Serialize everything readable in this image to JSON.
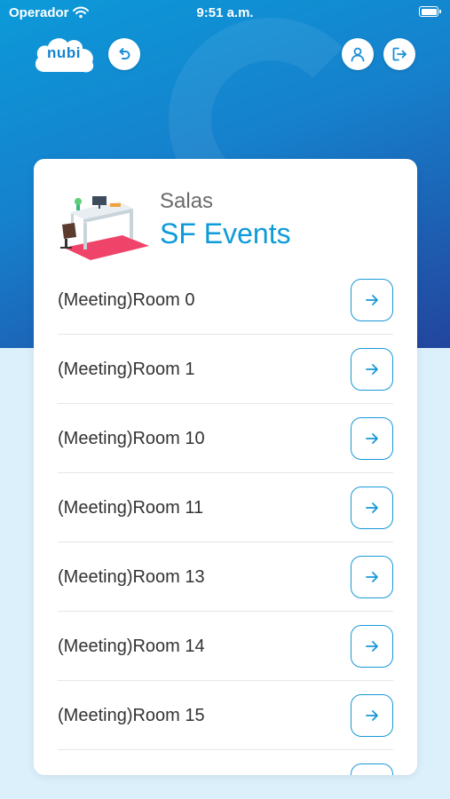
{
  "status_bar": {
    "carrier": "Operador",
    "time": "9:51 a.m."
  },
  "header": {
    "logo_text": "nubi",
    "back_icon": "undo-arrow-icon",
    "user_icon": "user-icon",
    "logout_icon": "logout-icon"
  },
  "card": {
    "subtitle": "Salas",
    "title": "SF Events",
    "rooms": [
      {
        "label": "(Meeting)Room 0"
      },
      {
        "label": "(Meeting)Room 1"
      },
      {
        "label": "(Meeting)Room 10"
      },
      {
        "label": "(Meeting)Room 11"
      },
      {
        "label": "(Meeting)Room 13"
      },
      {
        "label": "(Meeting)Room 14"
      },
      {
        "label": "(Meeting)Room 15"
      },
      {
        "label": ""
      }
    ]
  },
  "colors": {
    "accent": "#0e9bd9",
    "hero_top": "#0c9ad9",
    "hero_bottom": "#23459e",
    "page_background": "#dcf0fc"
  }
}
